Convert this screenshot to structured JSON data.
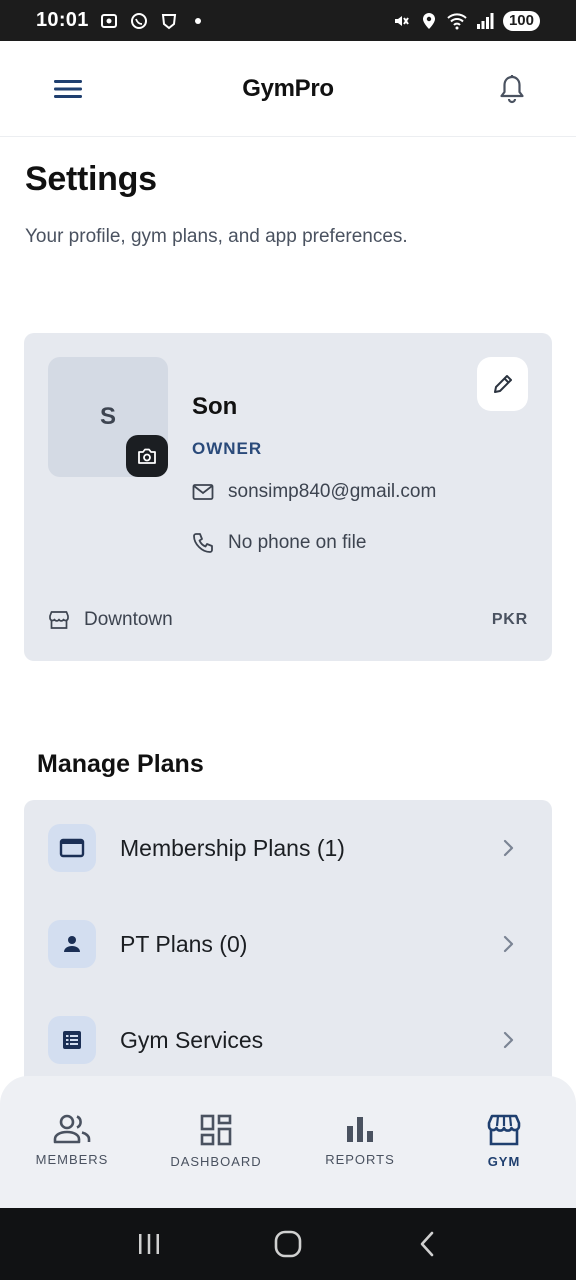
{
  "status_bar": {
    "time": "10:01",
    "battery": "100"
  },
  "app_bar": {
    "title": "GymPro",
    "icons": [
      "menu-icon",
      "bell-icon"
    ]
  },
  "page": {
    "title": "Settings",
    "subtitle": "Your profile, gym plans, and app preferences."
  },
  "profile": {
    "avatar_initial": "S",
    "name": "Son",
    "role": "OWNER",
    "email": "sonsimp840@gmail.com",
    "phone": "No phone on file",
    "location": "Downtown",
    "currency": "PKR"
  },
  "manage_plans": {
    "title": "Manage Plans",
    "items": [
      {
        "label": "Membership Plans (1)",
        "icon": "card-icon"
      },
      {
        "label": "PT Plans (0)",
        "icon": "person-icon"
      },
      {
        "label": "Gym Services",
        "icon": "list-icon"
      }
    ]
  },
  "bottom_nav": {
    "items": [
      {
        "label": "MEMBERS",
        "icon": "members-icon"
      },
      {
        "label": "DASHBOARD",
        "icon": "dashboard-icon"
      },
      {
        "label": "REPORTS",
        "icon": "reports-icon"
      },
      {
        "label": "GYM",
        "icon": "gym-icon",
        "active": true
      }
    ]
  },
  "colors": {
    "accent": "#1f3f6f",
    "card_bg": "#e6e9ef",
    "status_bar": "#1c1c1c"
  }
}
